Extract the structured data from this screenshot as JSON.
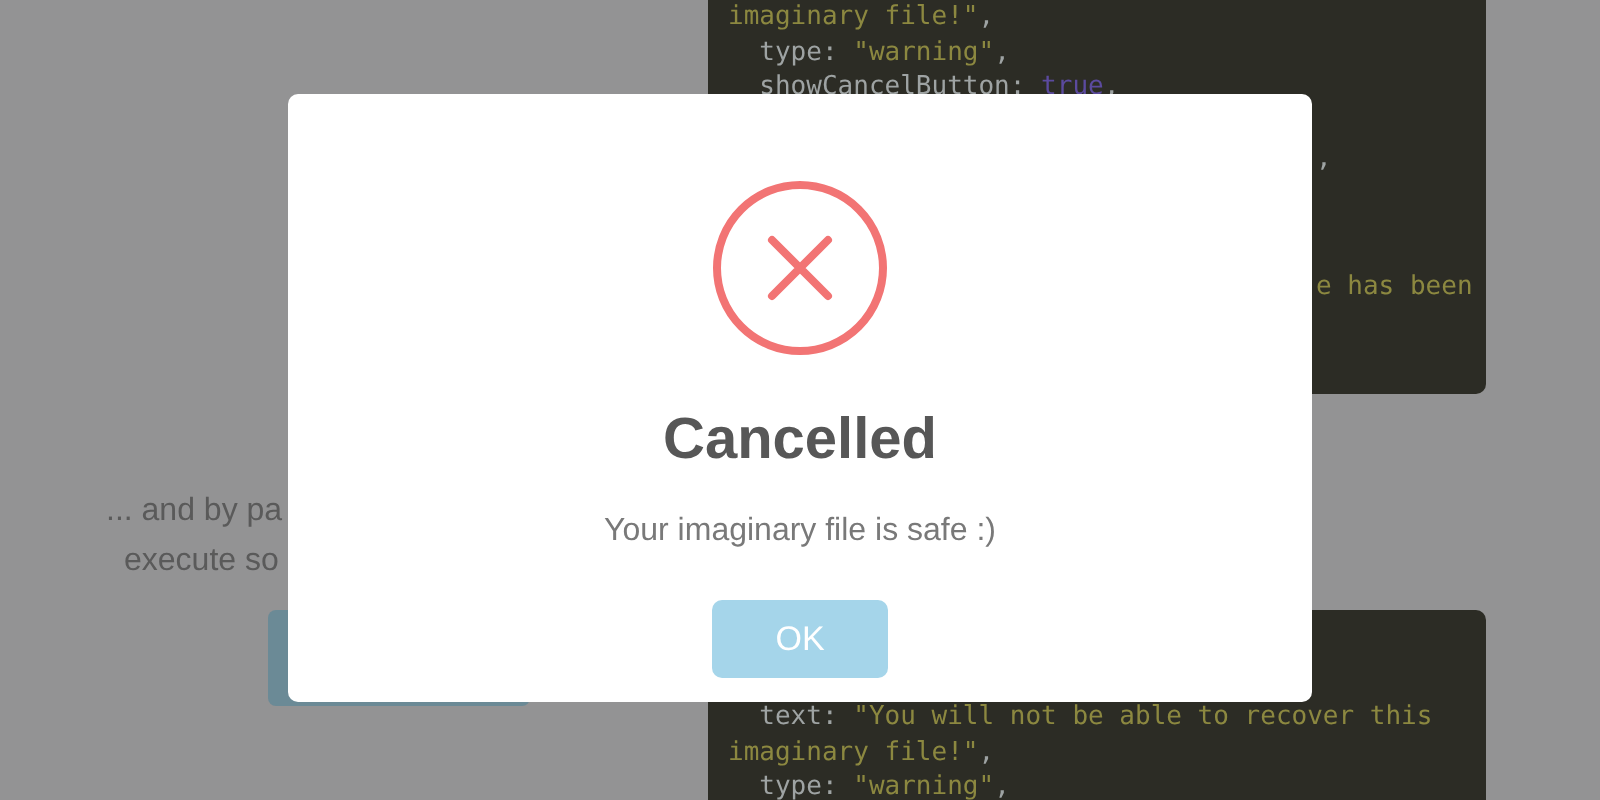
{
  "page": {
    "paragraph_lines": [
      "... and by pa",
      "execute so"
    ],
    "code_blocks": [
      {
        "lines": [
          {
            "kind": "full",
            "tokens": [
              {
                "text": "imaginary file!\"",
                "kind": "string"
              },
              {
                "text": ",",
                "kind": "plain"
              }
            ]
          },
          {
            "kind": "full",
            "tokens": [
              {
                "text": "  type: ",
                "kind": "plain"
              },
              {
                "text": "\"warning\"",
                "kind": "string"
              },
              {
                "text": ",",
                "kind": "plain"
              }
            ]
          },
          {
            "kind": "full",
            "tokens": [
              {
                "text": "  showCancelButton: ",
                "kind": "plain"
              },
              {
                "text": "true",
                "kind": "keyword"
              },
              {
                "text": ",",
                "kind": "plain"
              }
            ]
          },
          {
            "kind": "fragment",
            "tokens": [
              {
                "text": ",",
                "kind": "plain"
              }
            ]
          },
          {
            "kind": "fragment",
            "tokens": [
              {
                "text": "e has been",
                "kind": "string"
              }
            ]
          }
        ]
      },
      {
        "lines": [
          {
            "kind": "full",
            "tokens": [
              {
                "text": "  text: ",
                "kind": "plain"
              },
              {
                "text": "\"You will not be able to recover this",
                "kind": "string"
              }
            ]
          },
          {
            "kind": "full",
            "tokens": [
              {
                "text": "imaginary file!\"",
                "kind": "string"
              },
              {
                "text": ",",
                "kind": "plain"
              }
            ]
          },
          {
            "kind": "full",
            "tokens": [
              {
                "text": "  type: ",
                "kind": "plain"
              },
              {
                "text": "\"warning\"",
                "kind": "string"
              },
              {
                "text": ",",
                "kind": "plain"
              }
            ]
          }
        ]
      }
    ]
  },
  "dialog": {
    "kind": "error",
    "title": "Cancelled",
    "text": "Your imaginary file is safe :)",
    "button": "OK"
  }
}
